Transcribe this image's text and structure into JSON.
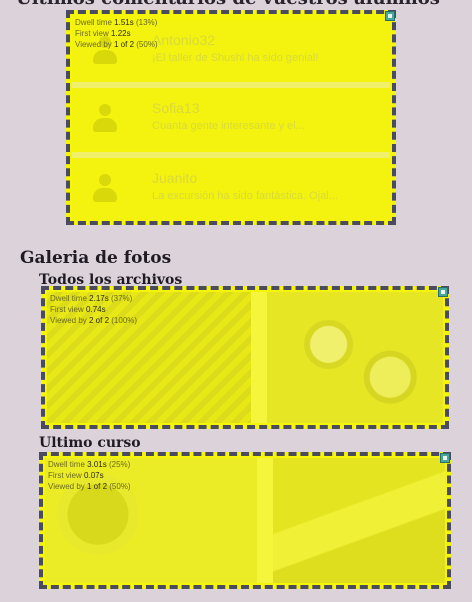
{
  "sections": {
    "comments_title": "Ultimos comentarios de vuestros alumnos",
    "gallery_title": "Galeria de fotos",
    "all_files_title": "Todos los archivos",
    "last_course_title": "Ultimo curso"
  },
  "comments": [
    {
      "name": "Antonio32",
      "text": "¡El taller de Shushi ha sido genial!"
    },
    {
      "name": "Sofia13",
      "text": "Cuanta gente interesante y el..."
    },
    {
      "name": "Juanito",
      "text": "La excursión ha sido fantástica. Ojal..."
    }
  ],
  "overlays": {
    "comments": {
      "dwell_label": "Dwell time",
      "dwell": "1.51s",
      "dwell_pct": "(13%)",
      "first_label": "First view",
      "first": "1.22s",
      "viewed_label": "Viewed by",
      "viewed": "1 of 2",
      "viewed_pct": "(50%)"
    },
    "all_files": {
      "dwell_label": "Dwell time",
      "dwell": "2.17s",
      "dwell_pct": "(37%)",
      "first_label": "First view",
      "first": "0.74s",
      "viewed_label": "Viewed by",
      "viewed": "2 of 2",
      "viewed_pct": "(100%)"
    },
    "last_course": {
      "dwell_label": "Dwell time",
      "dwell": "3.01s",
      "dwell_pct": "(25%)",
      "first_label": "First view",
      "first": "0.07s",
      "viewed_label": "Viewed by",
      "viewed": "1 of 2",
      "viewed_pct": "(50%)"
    }
  },
  "colors": {
    "highlight": "#f5f50a",
    "dash_border": "#4a4a60",
    "page_bg": "#dcd3da",
    "corner_icon": "#46a89c"
  },
  "icons": {
    "overlay_corner": "heatmap-marker-icon",
    "avatar": "user-avatar-icon"
  }
}
